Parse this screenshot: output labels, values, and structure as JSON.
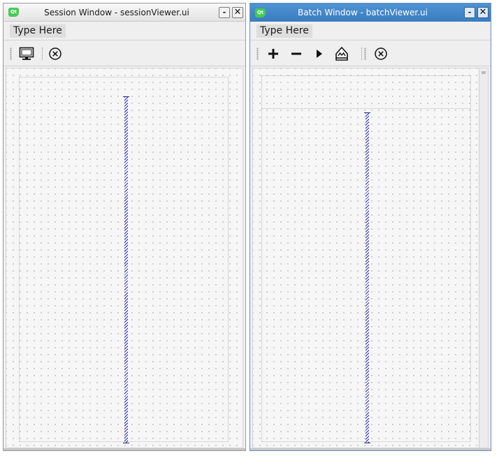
{
  "session_window": {
    "title": "Session Window - sessionViewer.ui",
    "minimize_glyph": "-",
    "close_glyph": "✕",
    "menu": {
      "type_here": "Type Here"
    },
    "toolbar": {
      "icons": [
        "monitor-icon",
        "stop-circle-icon"
      ]
    }
  },
  "batch_window": {
    "title": "Batch Window - batchViewer.ui",
    "minimize_glyph": "-",
    "close_glyph": "✕",
    "menu": {
      "type_here": "Type Here"
    },
    "toolbar": {
      "icons": [
        "plus-icon",
        "minus-icon",
        "play-icon",
        "clip-marker-icon",
        "stop-circle-icon"
      ]
    }
  },
  "colors": {
    "active_titlebar": "#3a7cbf",
    "inactive_titlebar": "#e8e8e8",
    "spacer": "#2222a0",
    "qt_logo": "#41cd52"
  }
}
